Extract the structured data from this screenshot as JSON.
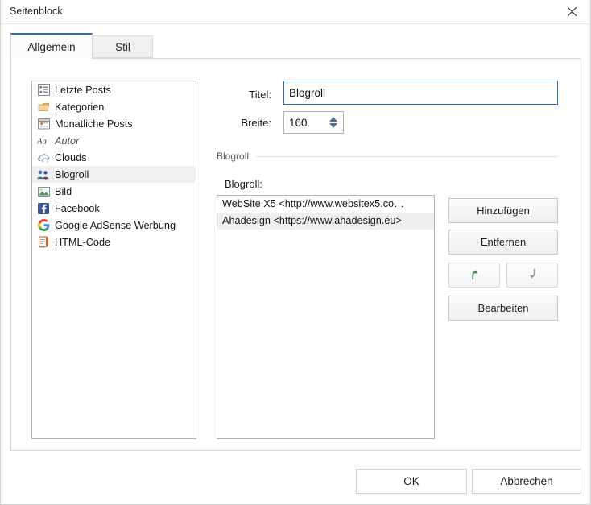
{
  "window": {
    "title": "Seitenblock",
    "close_icon": "close-icon"
  },
  "tabs": [
    {
      "label": "Allgemein",
      "active": true
    },
    {
      "label": "Stil",
      "active": false
    }
  ],
  "widget_list": {
    "items": [
      {
        "label": "Letzte Posts",
        "icon": "list-bullets-icon",
        "selected": false,
        "italic": false
      },
      {
        "label": "Kategorien",
        "icon": "folder-icon",
        "selected": false,
        "italic": false
      },
      {
        "label": "Monatliche Posts",
        "icon": "calendar-icon",
        "selected": false,
        "italic": false
      },
      {
        "label": "Autor",
        "icon": "font-aa-icon",
        "selected": false,
        "italic": true
      },
      {
        "label": "Clouds",
        "icon": "cloud-icon",
        "selected": false,
        "italic": false
      },
      {
        "label": "Blogroll",
        "icon": "users-icon",
        "selected": true,
        "italic": false
      },
      {
        "label": "Bild",
        "icon": "image-icon",
        "selected": false,
        "italic": false
      },
      {
        "label": "Facebook",
        "icon": "facebook-icon",
        "selected": false,
        "italic": false
      },
      {
        "label": "Google AdSense Werbung",
        "icon": "google-icon",
        "selected": false,
        "italic": false
      },
      {
        "label": "HTML-Code",
        "icon": "html-code-icon",
        "selected": false,
        "italic": false
      }
    ]
  },
  "form": {
    "title_label": "Titel:",
    "title_value": "Blogroll",
    "title_placeholder": "",
    "width_label": "Breite:",
    "width_value": "160",
    "spinner_up_icon": "triangle-up-icon",
    "spinner_down_icon": "triangle-down-icon"
  },
  "group": {
    "legend": "Blogroll"
  },
  "blogroll": {
    "list_label": "Blogroll:",
    "items": [
      {
        "label": "WebSite X5 <http://www.websitex5.co…",
        "selected": false
      },
      {
        "label": "Ahadesign <https://www.ahadesign.eu>",
        "selected": true
      }
    ]
  },
  "side_buttons": {
    "add": "Hinzufügen",
    "remove": "Entfernen",
    "move_up_icon": "arrow-up-icon",
    "move_down_icon": "arrow-down-icon",
    "edit": "Bearbeiten"
  },
  "footer": {
    "ok": "OK",
    "cancel": "Abbrechen"
  },
  "colors": {
    "accent": "#2b6cb8",
    "selection": "#efefef",
    "arrow_up": "#3f8a55",
    "arrow_down": "#8c8c8c",
    "spinner": "#4d6f95"
  }
}
